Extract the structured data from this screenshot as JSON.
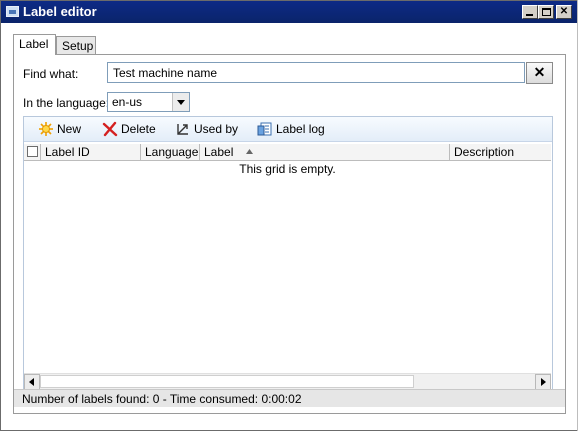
{
  "window": {
    "title": "Label editor"
  },
  "tabs": [
    {
      "label": "Label"
    },
    {
      "label": "Setup"
    }
  ],
  "find": {
    "label": "Find what:",
    "value": "Test machine name",
    "clear_label": "✕"
  },
  "language": {
    "label": "In the language:",
    "selected": "en-us"
  },
  "toolbar": {
    "new": "New",
    "delete": "Delete",
    "used_by": "Used by",
    "label_log": "Label log"
  },
  "grid": {
    "columns": [
      "Label ID",
      "Language",
      "Label",
      "Description"
    ],
    "sorted_column": "Label",
    "empty_message": "This grid is empty."
  },
  "status": {
    "text": "Number of labels found: 0 - Time consumed:  0:00:02"
  },
  "colors": {
    "titlebar": "#0a246a",
    "accent": "#e3edf8"
  }
}
